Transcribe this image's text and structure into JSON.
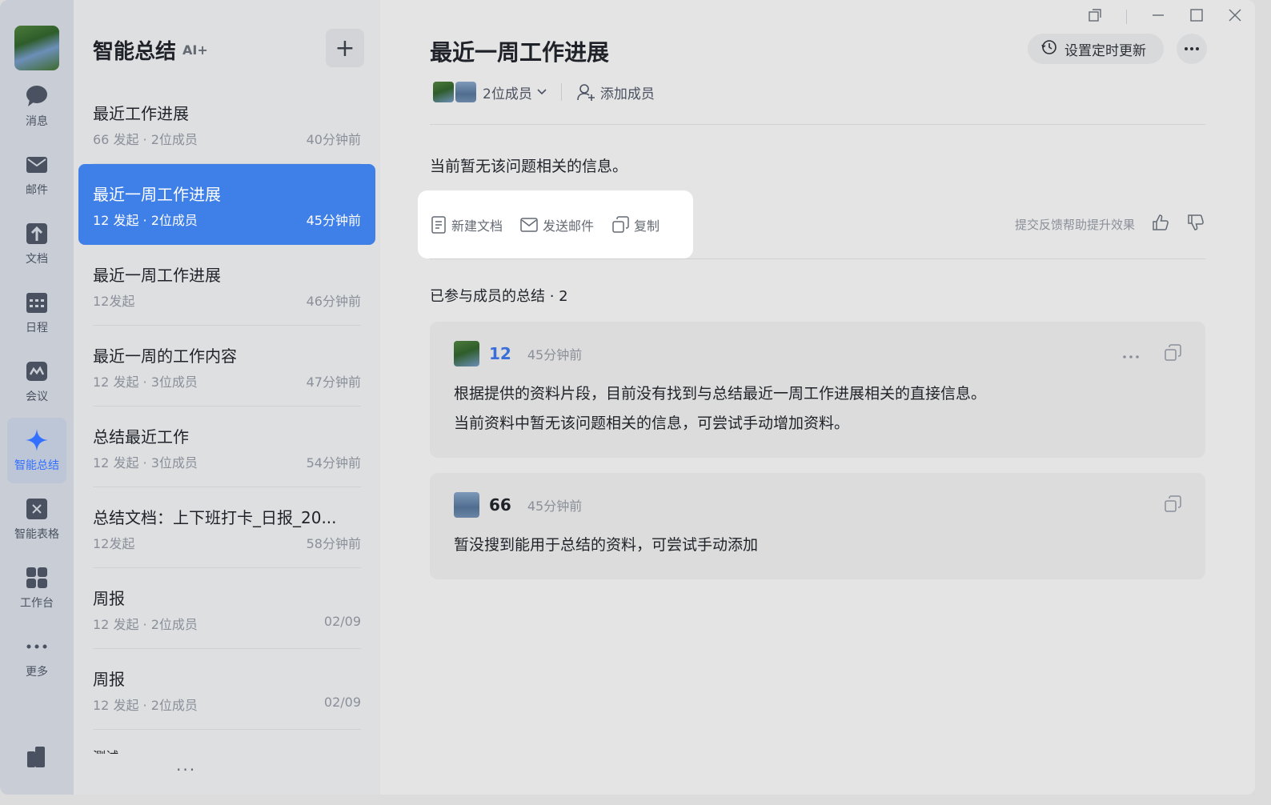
{
  "rail": {
    "items": [
      {
        "label": "消息",
        "icon": "message-icon"
      },
      {
        "label": "邮件",
        "icon": "mail-icon"
      },
      {
        "label": "文档",
        "icon": "docs-icon"
      },
      {
        "label": "日程",
        "icon": "calendar-icon"
      },
      {
        "label": "会议",
        "icon": "meeting-icon"
      },
      {
        "label": "智能总结",
        "icon": "sparkle-icon"
      },
      {
        "label": "智能表格",
        "icon": "smart-sheet-icon"
      },
      {
        "label": "工作台",
        "icon": "workbench-icon"
      },
      {
        "label": "更多",
        "icon": "more-icon"
      }
    ],
    "active_index": 5
  },
  "list": {
    "title": "智能总结",
    "ai_badge": "AI+",
    "add_label": "+",
    "items": [
      {
        "title": "最近工作进展",
        "meta": "66 发起 · 2位成员",
        "time": "40分钟前"
      },
      {
        "title": "最近一周工作进展",
        "meta": "12 发起 · 2位成员",
        "time": "45分钟前"
      },
      {
        "title": "最近一周工作进展",
        "meta": "12发起",
        "time": "46分钟前"
      },
      {
        "title": "最近一周的工作内容",
        "meta": "12 发起 · 3位成员",
        "time": "47分钟前"
      },
      {
        "title": "总结最近工作",
        "meta": "12 发起 · 3位成员",
        "time": "54分钟前"
      },
      {
        "title": "总结文档：上下班打卡_日报_20...",
        "meta": "12发起",
        "time": "58分钟前"
      },
      {
        "title": "周报",
        "meta": "12 发起 · 2位成员",
        "time": "02/09"
      },
      {
        "title": "周报",
        "meta": "12 发起 · 2位成员",
        "time": "02/09"
      }
    ],
    "partial_item": "测试",
    "more": "···"
  },
  "main": {
    "title": "最近一周工作进展",
    "members_label": "2位成员",
    "add_member_label": "添加成员",
    "schedule_label": "设置定时更新",
    "no_info": "当前暂无该问题相关的信息。",
    "actions": {
      "new_doc": "新建文档",
      "send_mail": "发送邮件",
      "copy": "复制"
    },
    "feedback": "提交反馈帮助提升效果",
    "section_title": "已参与成员的总结 · 2",
    "cards": [
      {
        "name": "12",
        "time": "45分钟前",
        "lines": [
          "根据提供的资料片段，目前没有找到与总结最近一周工作进展相关的直接信息。",
          "当前资料中暂无该问题相关的信息，可尝试手动增加资料。"
        ]
      },
      {
        "name": "66",
        "time": "45分钟前",
        "lines": [
          "暂没搜到能用于总结的资料，可尝试手动添加"
        ]
      }
    ]
  },
  "colors": {
    "accent": "#3370ff",
    "active_item": "#3f7fe8"
  }
}
